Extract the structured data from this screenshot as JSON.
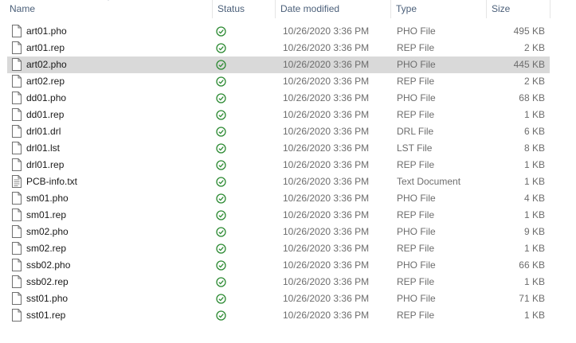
{
  "columns": {
    "name": "Name",
    "status": "Status",
    "date_modified": "Date modified",
    "type": "Type",
    "size": "Size"
  },
  "icons": {
    "file": "file-icon",
    "text_file": "text-document-icon",
    "status": "check-circle-icon",
    "sort": "sort-chevron-icon"
  },
  "colors": {
    "selected_row": "#d9d9d9",
    "status_ok": "#2e8b34",
    "header_text": "#4c607a"
  },
  "files": [
    {
      "name": "art01.pho",
      "date": "10/26/2020 3:36 PM",
      "type": "PHO File",
      "size": "495 KB",
      "selected": false,
      "text_doc": false
    },
    {
      "name": "art01.rep",
      "date": "10/26/2020 3:36 PM",
      "type": "REP File",
      "size": "2 KB",
      "selected": false,
      "text_doc": false
    },
    {
      "name": "art02.pho",
      "date": "10/26/2020 3:36 PM",
      "type": "PHO File",
      "size": "445 KB",
      "selected": true,
      "text_doc": false
    },
    {
      "name": "art02.rep",
      "date": "10/26/2020 3:36 PM",
      "type": "REP File",
      "size": "2 KB",
      "selected": false,
      "text_doc": false
    },
    {
      "name": "dd01.pho",
      "date": "10/26/2020 3:36 PM",
      "type": "PHO File",
      "size": "68 KB",
      "selected": false,
      "text_doc": false
    },
    {
      "name": "dd01.rep",
      "date": "10/26/2020 3:36 PM",
      "type": "REP File",
      "size": "1 KB",
      "selected": false,
      "text_doc": false
    },
    {
      "name": "drl01.drl",
      "date": "10/26/2020 3:36 PM",
      "type": "DRL File",
      "size": "6 KB",
      "selected": false,
      "text_doc": false
    },
    {
      "name": "drl01.lst",
      "date": "10/26/2020 3:36 PM",
      "type": "LST File",
      "size": "8 KB",
      "selected": false,
      "text_doc": false
    },
    {
      "name": "drl01.rep",
      "date": "10/26/2020 3:36 PM",
      "type": "REP File",
      "size": "1 KB",
      "selected": false,
      "text_doc": false
    },
    {
      "name": "PCB-info.txt",
      "date": "10/26/2020 3:36 PM",
      "type": "Text Document",
      "size": "1 KB",
      "selected": false,
      "text_doc": true
    },
    {
      "name": "sm01.pho",
      "date": "10/26/2020 3:36 PM",
      "type": "PHO File",
      "size": "4 KB",
      "selected": false,
      "text_doc": false
    },
    {
      "name": "sm01.rep",
      "date": "10/26/2020 3:36 PM",
      "type": "REP File",
      "size": "1 KB",
      "selected": false,
      "text_doc": false
    },
    {
      "name": "sm02.pho",
      "date": "10/26/2020 3:36 PM",
      "type": "PHO File",
      "size": "9 KB",
      "selected": false,
      "text_doc": false
    },
    {
      "name": "sm02.rep",
      "date": "10/26/2020 3:36 PM",
      "type": "REP File",
      "size": "1 KB",
      "selected": false,
      "text_doc": false
    },
    {
      "name": "ssb02.pho",
      "date": "10/26/2020 3:36 PM",
      "type": "PHO File",
      "size": "66 KB",
      "selected": false,
      "text_doc": false
    },
    {
      "name": "ssb02.rep",
      "date": "10/26/2020 3:36 PM",
      "type": "REP File",
      "size": "1 KB",
      "selected": false,
      "text_doc": false
    },
    {
      "name": "sst01.pho",
      "date": "10/26/2020 3:36 PM",
      "type": "PHO File",
      "size": "71 KB",
      "selected": false,
      "text_doc": false
    },
    {
      "name": "sst01.rep",
      "date": "10/26/2020 3:36 PM",
      "type": "REP File",
      "size": "1 KB",
      "selected": false,
      "text_doc": false
    }
  ]
}
